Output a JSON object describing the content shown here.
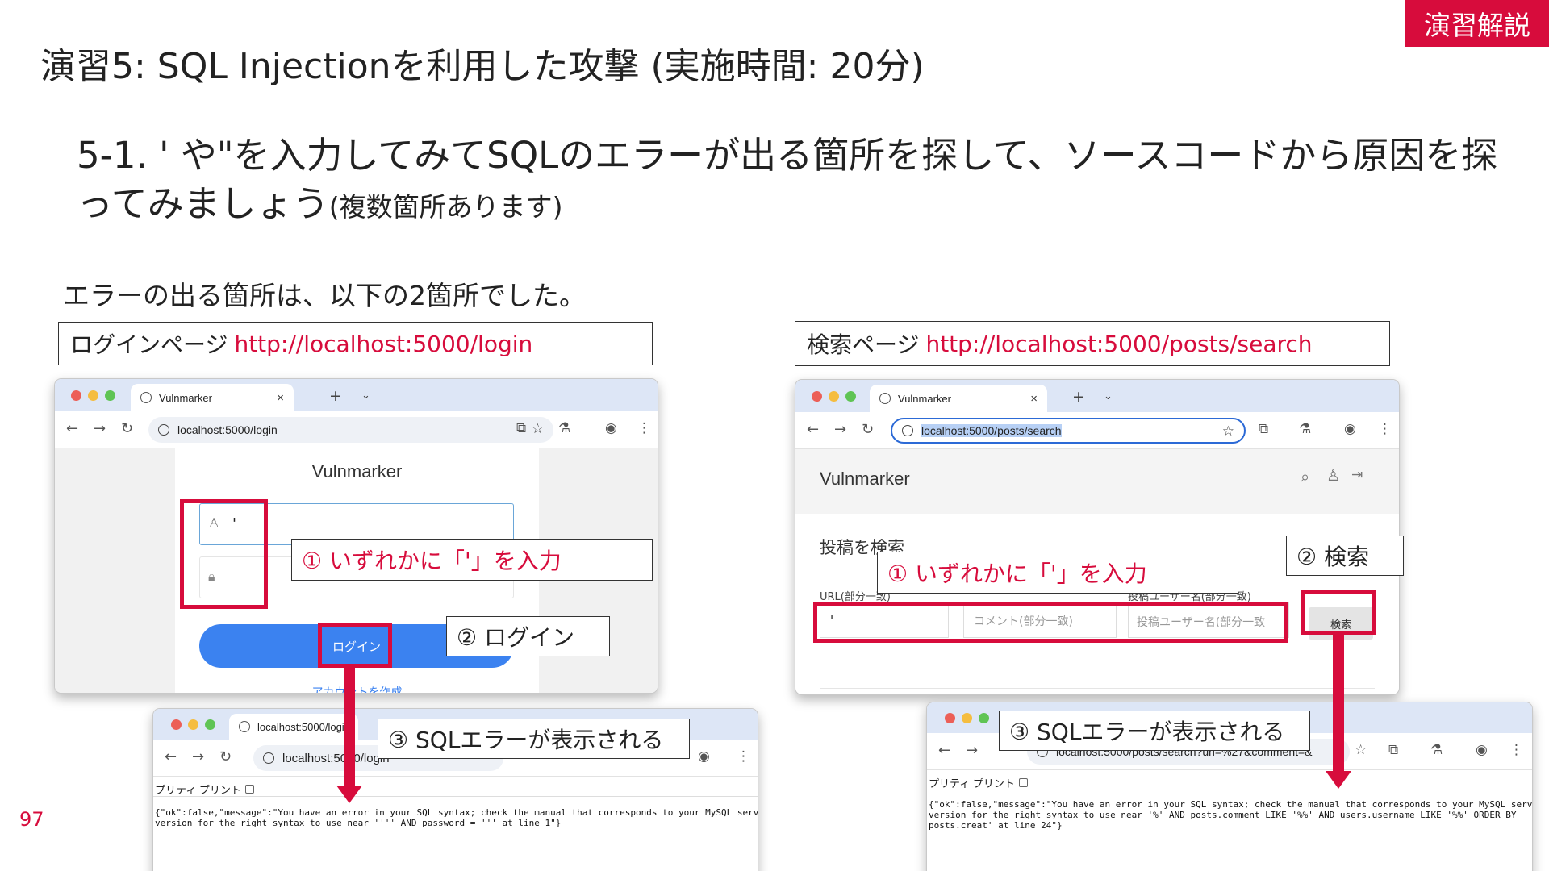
{
  "badge": "演習解説",
  "title": "演習5: SQL Injectionを利用した攻撃 (実施時間: 20分)",
  "subtitle": {
    "main": "5-1. ' や\"を入力してみてSQLのエラーが出る箇所を探して、ソースコードから原因を探ってみましょう",
    "note": "(複数箇所あります)"
  },
  "lead": "エラーの出る箇所は、以下の2箇所でした。",
  "page_number": "97",
  "login_section": {
    "label": "ログインページ",
    "url": "http://localhost:5000/login",
    "window": {
      "tab_title": "Vulnmarker",
      "address": "localhost:5000/login",
      "brand": "Vulnmarker",
      "username_value": "'",
      "login_button": "ログイン",
      "create_account": "アカウントを作成"
    },
    "result_window": {
      "tab_title": "localhost:5000/login",
      "address": "localhost:5000/login",
      "pretty_print": "プリティ プリント",
      "output": "{\"ok\":false,\"message\":\"You have an error in your SQL syntax; check the manual that corresponds to your MySQL server\nversion for the right syntax to use near '''' AND password = ''' at line 1\"}"
    },
    "callout_input": "① いずれかに「'」を入力",
    "callout_login": "② ログイン",
    "callout_error": "③ SQLエラーが表示される"
  },
  "search_section": {
    "label": "検索ページ",
    "url": "http://localhost:5000/posts/search",
    "window": {
      "tab_title": "Vulnmarker",
      "address": "localhost:5000/posts/search",
      "brand": "Vulnmarker",
      "heading": "投稿を検索",
      "url_label": "URL(部分一致)",
      "url_value": "'",
      "comment_placeholder": "コメント(部分一致)",
      "user_label": "投稿ユーザー名(部分一致)",
      "user_placeholder": "投稿ユーザー名(部分一致",
      "search_button": "検索"
    },
    "result_window": {
      "address": "localhost:5000/posts/search?url=%27&comment=&",
      "pretty_print": "プリティ プリント",
      "output": "{\"ok\":false,\"message\":\"You have an error in your SQL syntax; check the manual that corresponds to your MySQL server\nversion for the right syntax to use near '%' AND posts.comment LIKE '%%' AND users.username LIKE '%%' ORDER BY\nposts.creat' at line 24\"}"
    },
    "callout_input": "① いずれかに「'」を入力",
    "callout_search": "② 検索",
    "callout_error": "③ SQLエラーが表示される"
  },
  "colors": {
    "accent": "#d70c3c",
    "browser_frame": "#dde6f6",
    "button_blue": "#3b82f0"
  }
}
